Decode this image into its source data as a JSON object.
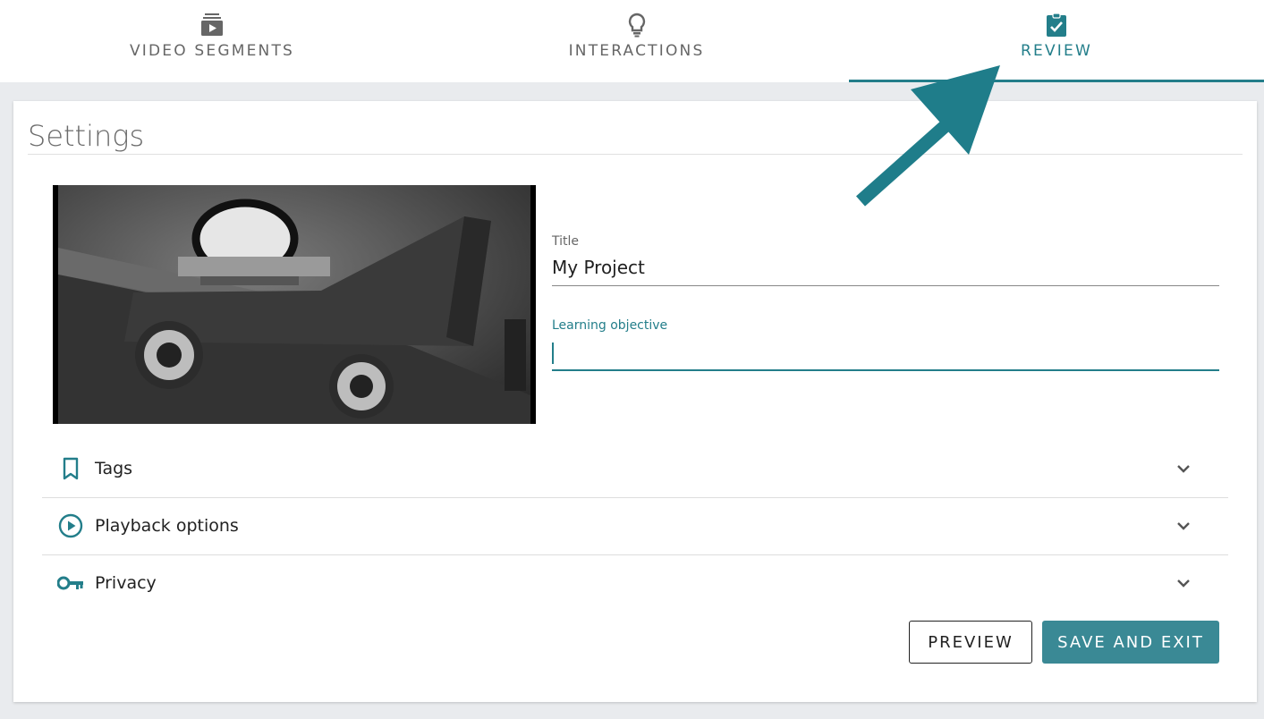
{
  "tabs": [
    {
      "label": "VIDEO SEGMENTS",
      "icon": "video-segments-icon",
      "active": false
    },
    {
      "label": "INTERACTIONS",
      "icon": "lightbulb-icon",
      "active": false
    },
    {
      "label": "REVIEW",
      "icon": "clipboard-check-icon",
      "active": true
    }
  ],
  "settings": {
    "title": "Settings",
    "title_field": {
      "label": "Title",
      "value": "My Project"
    },
    "objective_field": {
      "label": "Learning objective",
      "value": ""
    }
  },
  "accordions": [
    {
      "label": "Tags",
      "icon": "bookmark-icon"
    },
    {
      "label": "Playback options",
      "icon": "play-circle-icon"
    },
    {
      "label": "Privacy",
      "icon": "key-icon"
    }
  ],
  "buttons": {
    "preview": "PREVIEW",
    "save": "SAVE AND EXIT"
  },
  "colors": {
    "accent": "#237e8a",
    "button": "#3a8995",
    "background": "#e9ebee"
  }
}
